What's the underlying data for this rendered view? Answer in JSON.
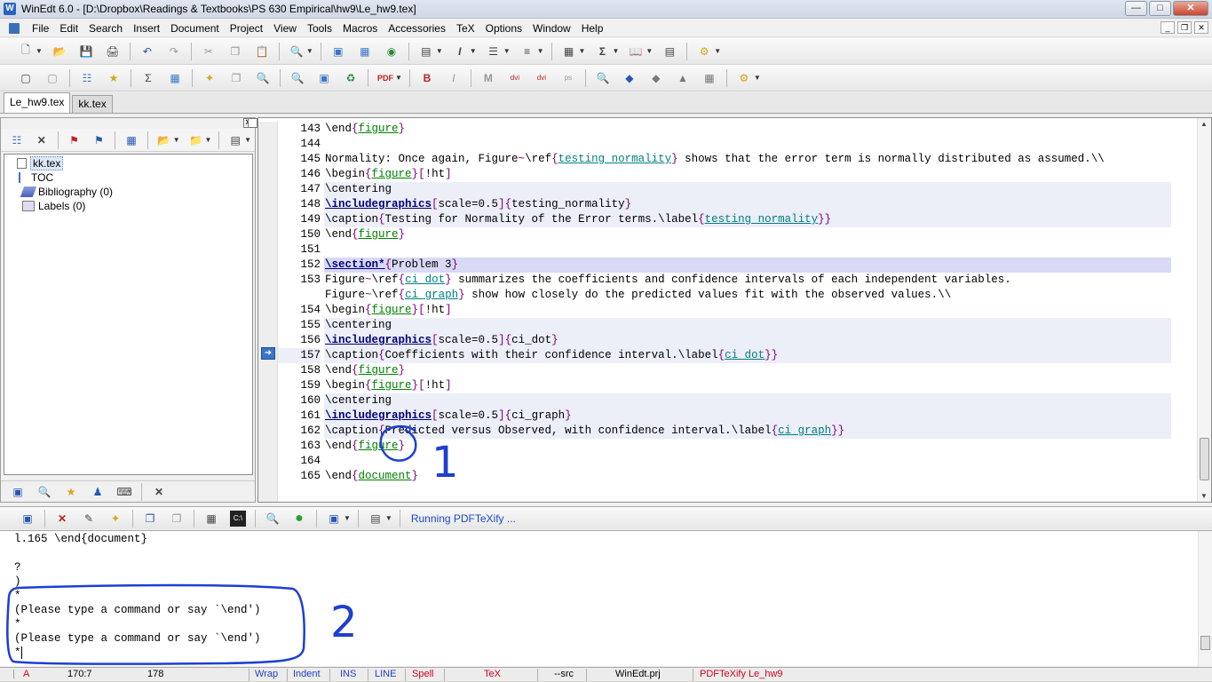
{
  "window": {
    "title": "WinEdt 6.0 - [D:\\Dropbox\\Readings & Textbooks\\PS 630 Empirical\\hw9\\Le_hw9.tex]"
  },
  "menu": [
    "File",
    "Edit",
    "Search",
    "Insert",
    "Document",
    "Project",
    "View",
    "Tools",
    "Macros",
    "Accessories",
    "TeX",
    "Options",
    "Window",
    "Help"
  ],
  "tabs": [
    {
      "label": "Le_hw9.tex",
      "active": true
    },
    {
      "label": "kk.tex",
      "active": false
    }
  ],
  "tree": {
    "items": [
      {
        "label": "kk.tex",
        "icon": "tex-file-icon",
        "selected": true
      },
      {
        "label": "TOC",
        "icon": "toc-icon"
      },
      {
        "label": "Bibliography  (0)",
        "icon": "bibliography-icon"
      },
      {
        "label": "Labels  (0)",
        "icon": "labels-icon"
      }
    ]
  },
  "editor": {
    "current_line": 157,
    "lines": [
      {
        "n": "143",
        "text": "\\end{figure}"
      },
      {
        "n": "144",
        "text": ""
      },
      {
        "n": "145",
        "text": "Normality: Once again, Figure~\\ref{testing normality} shows that the error term is normally distributed as assumed.\\\\"
      },
      {
        "n": "146",
        "text": "\\begin{figure}[!ht]"
      },
      {
        "n": "147",
        "text": "\\centering"
      },
      {
        "n": "148",
        "text": "\\includegraphics[scale=0.5]{testing_normality}"
      },
      {
        "n": "149",
        "text": "\\caption{Testing for Normality of the Error terms.\\label{testing normality}}"
      },
      {
        "n": "150",
        "text": "\\end{figure}"
      },
      {
        "n": "151",
        "text": ""
      },
      {
        "n": "152",
        "text": "\\section*{Problem 3}"
      },
      {
        "n": "153",
        "text": "Figure~\\ref{ci dot} summarizes the coefficients and confidence intervals of each independent variables."
      },
      {
        "n": "",
        "text": "Figure~\\ref{ci graph} show how closely do the predicted values fit with the observed values.\\\\"
      },
      {
        "n": "154",
        "text": "\\begin{figure}[!ht]"
      },
      {
        "n": "155",
        "text": "\\centering"
      },
      {
        "n": "156",
        "text": "\\includegraphics[scale=0.5]{ci_dot}"
      },
      {
        "n": "157",
        "text": "\\caption{Coefficients with their confidence interval.\\label{ci dot}}"
      },
      {
        "n": "158",
        "text": "\\end{figure}"
      },
      {
        "n": "159",
        "text": "\\begin{figure}[!ht]"
      },
      {
        "n": "160",
        "text": "\\centering"
      },
      {
        "n": "161",
        "text": "\\includegraphics[scale=0.5]{ci_graph}"
      },
      {
        "n": "162",
        "text": "\\caption{Predicted versus Observed, with confidence interval.\\label{ci graph}}"
      },
      {
        "n": "163",
        "text": "\\end{figure}"
      },
      {
        "n": "164",
        "text": ""
      },
      {
        "n": "165",
        "text": "\\end{document}"
      }
    ]
  },
  "output_toolbar": {
    "status": "Running PDFTeXify ..."
  },
  "output": {
    "lines": [
      "l.165 \\end{document}",
      "",
      "?",
      ")",
      "*",
      "(Please type a command or say `\\end')",
      "*",
      "(Please type a command or say `\\end')",
      "*"
    ]
  },
  "annotations": [
    "1",
    "2"
  ],
  "statusbar": {
    "mode": "A",
    "position": "170:7",
    "lines": "178",
    "wrap": "Wrap",
    "indent": "Indent",
    "ins": "INS",
    "line": "LINE",
    "spell": "Spell",
    "tex": "TeX",
    "src": "--src",
    "project": "WinEdt.prj",
    "task": "PDFTeXify Le_hw9"
  },
  "colors": {
    "accent_blue": "#1f3fbf",
    "annotation_blue": "#1e3fd0",
    "status_red": "#d0021b",
    "env_green": "#008000",
    "ref_teal": "#008080",
    "brace_purple": "#800080"
  }
}
